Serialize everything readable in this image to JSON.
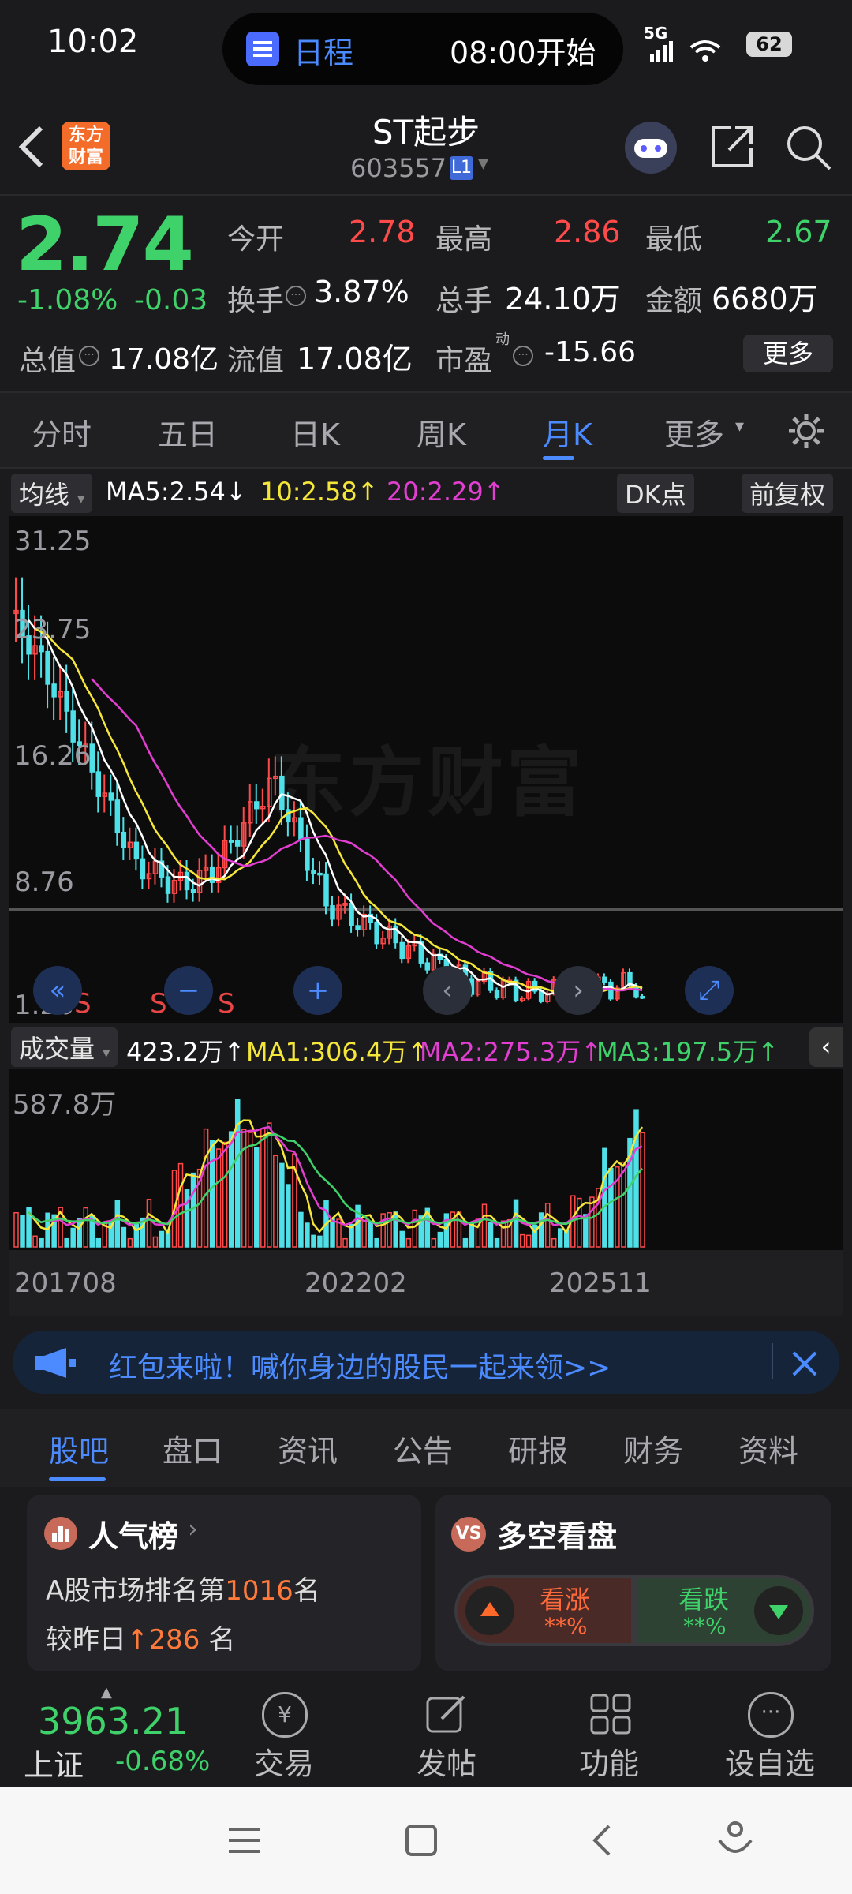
{
  "status_bar": {
    "time": "10:02",
    "pill_app": "日程",
    "pill_text": "08:00开始",
    "network": "5G",
    "battery": "62"
  },
  "header": {
    "title": "ST起步",
    "code": "603557",
    "level_badge": "L1",
    "logo_text_1": "东方",
    "logo_text_2": "财富"
  },
  "quote": {
    "price": "2.74",
    "change_pct": "-1.08%",
    "change": "-0.03",
    "open_label": "今开",
    "open": "2.78",
    "high_label": "最高",
    "high": "2.86",
    "low_label": "最低",
    "low": "2.67",
    "turnover_label": "换手",
    "turnover": "3.87%",
    "volume_label": "总手",
    "volume": "24.10万",
    "amount_label": "金额",
    "amount": "6680万",
    "mcap_label": "总值",
    "mcap": "17.08亿",
    "float_label": "流值",
    "float": "17.08亿",
    "pe_label": "市盈",
    "pe_sup": "动",
    "pe": "-15.66",
    "more_label": "更多"
  },
  "chart_tabs": [
    "分时",
    "五日",
    "日K",
    "周K",
    "月K",
    "更多"
  ],
  "chart_active_tab": "月K",
  "ma_bar": {
    "ma_selector": "均线",
    "ma5": "MA5:2.54",
    "ma5_arrow": "↓",
    "ma10": "10:2.58",
    "ma10_arrow": "↑",
    "ma20": "20:2.29",
    "ma20_arrow": "↑",
    "dk_label": "DK点",
    "adjust_label": "前复权"
  },
  "vol_bar": {
    "selector": "成交量",
    "vol": "423.2万",
    "vol_arrow": "↑",
    "ma1": "MA1:306.4万",
    "ma1_arrow": "↑",
    "ma2": "MA2:275.3万",
    "ma2_arrow": "↑",
    "ma3": "MA3:197.5万",
    "ma3_arrow": "↑"
  },
  "watermark": "东方财富",
  "chart_data": {
    "type": "candlestick",
    "ylabels": [
      "31.25",
      "23.75",
      "16.26",
      "8.76",
      "1.26"
    ],
    "volume_max_label": "587.8万",
    "xlabels": [
      "201708",
      "202202",
      "202511"
    ],
    "sell_marks": [
      "S",
      "S",
      "S"
    ]
  },
  "banner": {
    "text": "红包来啦！喊你身边的股民一起来领>>"
  },
  "bottom_tabs": [
    "股吧",
    "盘口",
    "资讯",
    "公告",
    "研报",
    "财务",
    "资料"
  ],
  "popularity_card": {
    "title": "人气榜",
    "line1_prefix": "A股市场排名第",
    "rank": "1016",
    "line1_suffix": "名",
    "line2_prefix": "较昨日",
    "delta": "286",
    "line2_suffix": "名"
  },
  "vs_card": {
    "title": "多空看盘",
    "bull_label": "看涨",
    "bull_value": "**%",
    "bear_label": "看跌",
    "bear_value": "**%"
  },
  "index": {
    "value": "3963.21",
    "name": "上证",
    "change": "-0.68%"
  },
  "bottom_bar": [
    "交易",
    "发帖",
    "功能",
    "设自选"
  ]
}
